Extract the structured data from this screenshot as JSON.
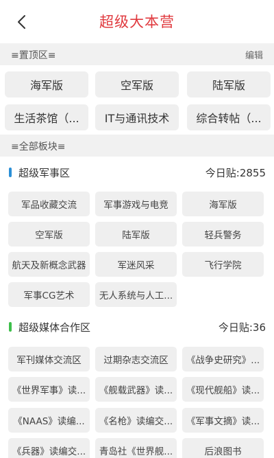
{
  "header": {
    "title": "超级大本营"
  },
  "pinned_section": {
    "label": "≡置顶区≡",
    "edit_label": "编辑",
    "items": [
      "海军版",
      "空军版",
      "陆军版",
      "生活茶馆（...",
      "IT与通讯技术",
      "综合转帖（..."
    ]
  },
  "all_section": {
    "label": "≡全部板块≡"
  },
  "groups": [
    {
      "name": "超级军事区",
      "count": "今日贴:2855",
      "marker_color": "#2b8fd6",
      "boards": [
        "军品收藏交流",
        "军事游戏与电竞",
        "海军版",
        "空军版",
        "陆军版",
        "轻兵警务",
        "航天及新概念武器",
        "军迷风采",
        "飞行学院",
        "军事CG艺术",
        "无人系统与人工..."
      ]
    },
    {
      "name": "超级媒体合作区",
      "count": "今日贴:36",
      "marker_color": "#3dbf4a",
      "boards": [
        "军刊媒体交流区",
        "过期杂志交流区",
        "《战争史研究》...",
        "《世界军事》读...",
        "《舰载武器》读...",
        "《现代舰船》读...",
        "《NAAS》读编...",
        "《名枪》读编交...",
        "《军事文摘》读...",
        "《兵器》读编交...",
        "青岛社《世界舰...",
        "后浪图书"
      ]
    }
  ]
}
